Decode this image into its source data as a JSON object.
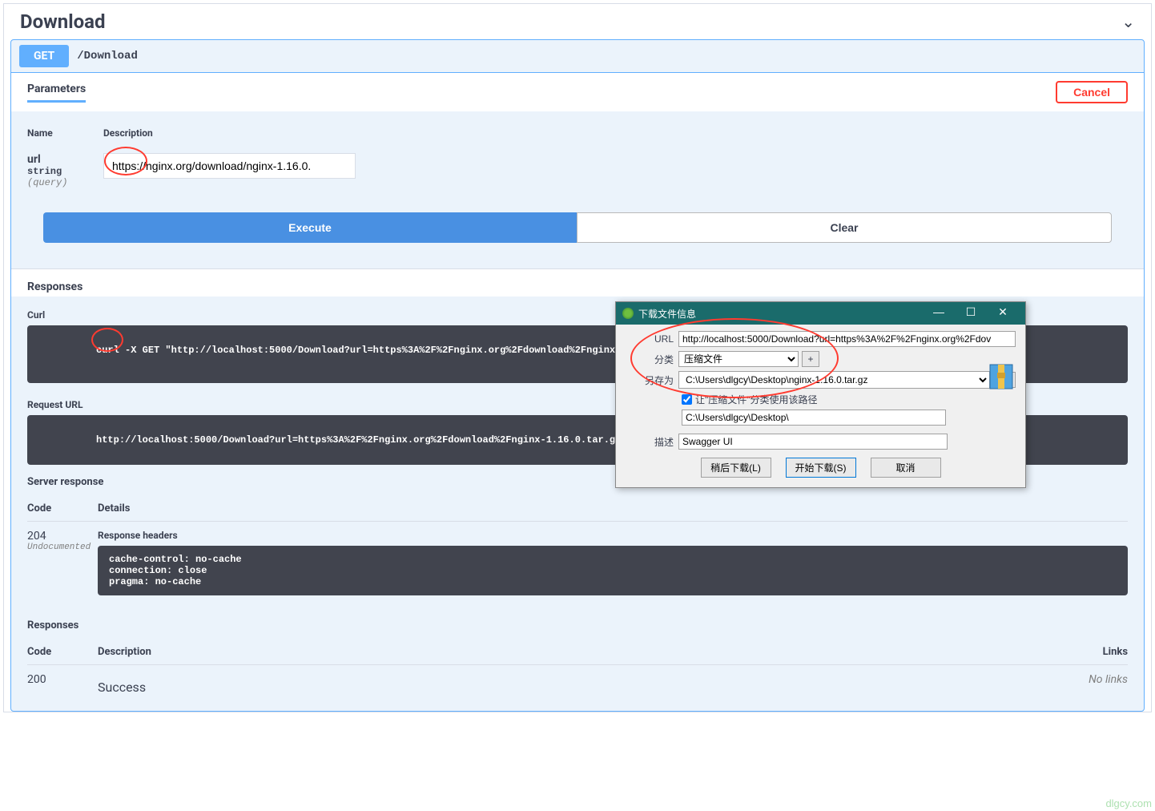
{
  "header": {
    "title": "Download"
  },
  "operation": {
    "method": "GET",
    "path": "/Download",
    "parameters_label": "Parameters",
    "cancel_label": "Cancel",
    "table": {
      "name_header": "Name",
      "desc_header": "Description",
      "param_name": "url",
      "param_type": "string",
      "param_loc": "(query)",
      "url_value": "https://nginx.org/download/nginx-1.16.0."
    },
    "execute_label": "Execute",
    "clear_label": "Clear"
  },
  "responses": {
    "title": "Responses",
    "curl_label": "Curl",
    "curl_cmd": "curl -X GET \"http://localhost:5000/Download?url=https%3A%2F%2Fnginx.org%2Fdownload%2Fnginx-1.16.0.tar.gz\" -H \"accept: */*\"",
    "request_url_label": "Request URL",
    "request_url": "http://localhost:5000/Download?url=https%3A%2F%2Fnginx.org%2Fdownload%2Fnginx-1.16.0.tar.gz",
    "server_response_label": "Server response",
    "code_header": "Code",
    "details_header": "Details",
    "code_204": "204",
    "undocumented": "Undocumented",
    "response_headers_label": "Response headers",
    "response_headers": "cache-control: no-cache\nconnection: close\npragma: no-cache",
    "responses_label2": "Responses",
    "desc_header2": "Description",
    "links_header": "Links",
    "code_200": "200",
    "success_label": "Success",
    "no_links": "No links"
  },
  "idm": {
    "title": "下载文件信息",
    "url_label": "URL",
    "url_value": "http://localhost:5000/Download?url=https%3A%2F%2Fnginx.org%2Fdov",
    "category_label": "分类",
    "category_value": "压缩文件",
    "saveas_label": "另存为",
    "saveas_value": "C:\\Users\\dlgcy\\Desktop\\nginx-1.16.0.tar.gz",
    "checkbox_label": "让\"压缩文件\"分类使用该路径",
    "path_value": "C:\\Users\\dlgcy\\Desktop\\",
    "desc_label": "描述",
    "desc_value": "Swagger UI",
    "later_btn": "稍后下载(L)",
    "start_btn": "开始下载(S)",
    "cancel_btn": "取消"
  },
  "watermark": "dlgcy.com"
}
